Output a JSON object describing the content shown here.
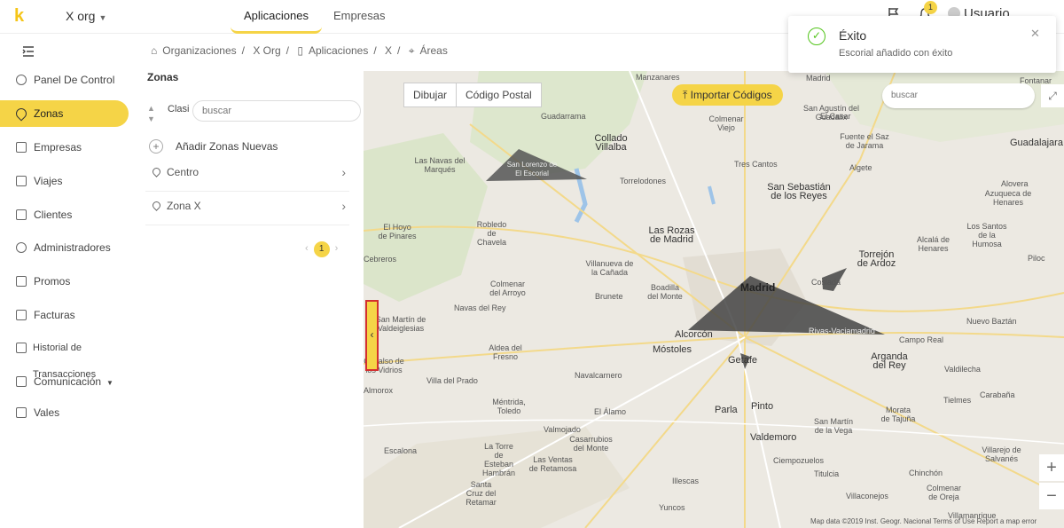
{
  "header": {
    "org_name": "X org",
    "tabs": [
      {
        "label": "Aplicaciones",
        "active": true
      },
      {
        "label": "Empresas",
        "active": false
      }
    ],
    "notification_count": "1",
    "user_name": "Usuario"
  },
  "sidebar": {
    "items": [
      {
        "label": "Panel De Control",
        "icon": "dashboard-icon"
      },
      {
        "label": "Zonas",
        "icon": "location-pin-icon",
        "active": true
      },
      {
        "label": "Empresas",
        "icon": "building-icon"
      },
      {
        "label": "Viajes",
        "icon": "car-icon"
      },
      {
        "label": "Clientes",
        "icon": "id-card-icon"
      },
      {
        "label": "Administradores",
        "icon": "users-icon"
      },
      {
        "label": "Promos",
        "icon": "gift-icon"
      },
      {
        "label": "Facturas",
        "icon": "invoice-icon"
      },
      {
        "label": "Historial de Transacciones",
        "icon": "edit-icon"
      },
      {
        "label": "Comunicación",
        "icon": "message-icon"
      },
      {
        "label": "Vales",
        "icon": "gift-icon"
      }
    ]
  },
  "breadcrumb": [
    "Organizaciones",
    "X Org",
    "Aplicaciones",
    "X",
    "Áreas"
  ],
  "zones": {
    "title": "Zonas",
    "sort_label": "Clasi",
    "search_placeholder": "buscar",
    "add_label": "Añadir Zonas Nuevas",
    "items": [
      "Centro",
      "Zona X"
    ],
    "page": "1"
  },
  "map": {
    "tools": [
      "Dibujar",
      "Código Postal"
    ],
    "import_label": "Importar Códigos",
    "search_placeholder": "buscar",
    "attribution": "Map data ©2019 Inst. Geogr. Nacional    Terms of Use    Report a map error",
    "labels": [
      {
        "text": "Manzanares",
        "cls": ""
      },
      {
        "text": "Madrid",
        "cls": ""
      },
      {
        "text": "Fontanar",
        "cls": ""
      },
      {
        "text": "Guadarrama",
        "cls": ""
      },
      {
        "text": "Colmenar Viejo",
        "cls": ""
      },
      {
        "text": "San Agustín del Guadalix",
        "cls": ""
      },
      {
        "text": "Collado Villalba",
        "cls": "big"
      },
      {
        "text": "Las Navas del Marqués",
        "cls": ""
      },
      {
        "text": "San Lorenzo de El Escorial",
        "cls": ""
      },
      {
        "text": "Torrelodones",
        "cls": ""
      },
      {
        "text": "Tres Cantos",
        "cls": ""
      },
      {
        "text": "El Casar",
        "cls": ""
      },
      {
        "text": "Fuente el Saz de Jarama",
        "cls": ""
      },
      {
        "text": "Algete",
        "cls": ""
      },
      {
        "text": "Guadalajara",
        "cls": "big"
      },
      {
        "text": "San Sebastián de los Reyes",
        "cls": "big"
      },
      {
        "text": "Alovera",
        "cls": ""
      },
      {
        "text": "Azuqueca de Henares",
        "cls": ""
      },
      {
        "text": "El Hoyo de Pinares",
        "cls": ""
      },
      {
        "text": "Robledo de Chavela",
        "cls": ""
      },
      {
        "text": "Las Rozas de Madrid",
        "cls": "big"
      },
      {
        "text": "Torrejón de Ardoz",
        "cls": "big"
      },
      {
        "text": "Alcalá de Henares",
        "cls": ""
      },
      {
        "text": "Los Santos de la Humosa",
        "cls": ""
      },
      {
        "text": "Cebreros",
        "cls": ""
      },
      {
        "text": "Villanueva de la Cañada",
        "cls": ""
      },
      {
        "text": "Piloc",
        "cls": ""
      },
      {
        "text": "Colmenar del Arroyo",
        "cls": ""
      },
      {
        "text": "Brunete",
        "cls": ""
      },
      {
        "text": "Boadilla del Monte",
        "cls": ""
      },
      {
        "text": "Madrid",
        "cls": "bold"
      },
      {
        "text": "Coslada",
        "cls": ""
      },
      {
        "text": "San Martín de Valdeiglesias",
        "cls": ""
      },
      {
        "text": "Navas del Rey",
        "cls": ""
      },
      {
        "text": "Nuevo Baztán",
        "cls": ""
      },
      {
        "text": "Alcorcón",
        "cls": "big"
      },
      {
        "text": "Rivas-Vaciamadrid",
        "cls": ""
      },
      {
        "text": "Campo Real",
        "cls": ""
      },
      {
        "text": "Móstoles",
        "cls": "big"
      },
      {
        "text": "Aldea del Fresno",
        "cls": ""
      },
      {
        "text": "Getafe",
        "cls": "big"
      },
      {
        "text": "Arganda del Rey",
        "cls": "big"
      },
      {
        "text": "Valdilecha",
        "cls": ""
      },
      {
        "text": "Cadalso de los Vidrios",
        "cls": ""
      },
      {
        "text": "Villa del Prado",
        "cls": ""
      },
      {
        "text": "Navalcarnero",
        "cls": ""
      },
      {
        "text": "Almorox",
        "cls": ""
      },
      {
        "text": "Tielmes",
        "cls": ""
      },
      {
        "text": "Carabaña",
        "cls": ""
      },
      {
        "text": "Méntrida, Toledo",
        "cls": ""
      },
      {
        "text": "El Álamo",
        "cls": ""
      },
      {
        "text": "Parla",
        "cls": "big"
      },
      {
        "text": "Pinto",
        "cls": "big"
      },
      {
        "text": "San Martín de la Vega",
        "cls": ""
      },
      {
        "text": "Morata de Tajuña",
        "cls": ""
      },
      {
        "text": "Valmojado",
        "cls": ""
      },
      {
        "text": "Casarrubios del Monte",
        "cls": ""
      },
      {
        "text": "Valdemoro",
        "cls": "big"
      },
      {
        "text": "Villarejo de Salvanés",
        "cls": ""
      },
      {
        "text": "La Torre de Esteban Hambrán",
        "cls": ""
      },
      {
        "text": "Las Ventas de Retamosa",
        "cls": ""
      },
      {
        "text": "Escalona",
        "cls": ""
      },
      {
        "text": "Ciempozuelos",
        "cls": ""
      },
      {
        "text": "Chinchón",
        "cls": ""
      },
      {
        "text": "Santa Cruz del Retamar",
        "cls": ""
      },
      {
        "text": "Illescas",
        "cls": ""
      },
      {
        "text": "Titulcia",
        "cls": ""
      },
      {
        "text": "Villaconejos",
        "cls": ""
      },
      {
        "text": "Colmenar de Oreja",
        "cls": ""
      },
      {
        "text": "Yuncos",
        "cls": ""
      },
      {
        "text": "Villamanrique",
        "cls": ""
      }
    ]
  },
  "toast": {
    "title": "Éxito",
    "message": "Escorial añadido con éxito"
  }
}
